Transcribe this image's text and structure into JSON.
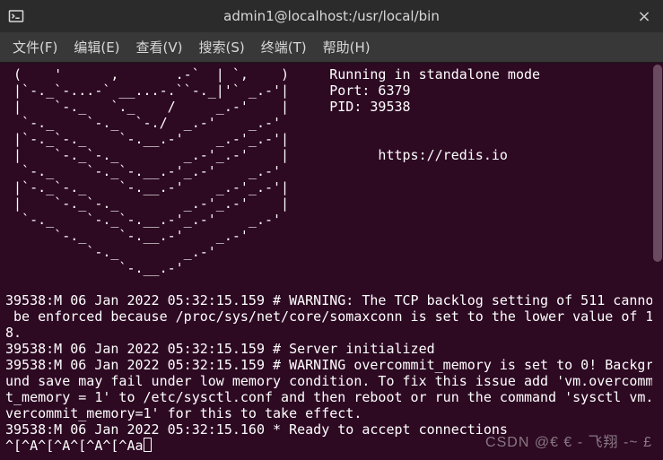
{
  "window": {
    "title": "admin1@localhost:/usr/local/bin",
    "close_label": "×"
  },
  "menu": {
    "file": "文件(F)",
    "edit": "编辑(E)",
    "view": "查看(V)",
    "search": "搜索(S)",
    "terminal": "终端(T)",
    "help": "帮助(H)"
  },
  "terminal": {
    "ascii_art": " (    '      ,       .-`  | `,    )     Running in standalone mode\n |`-._`-...-` __...-.``-._|'` _.-'|     Port: 6379\n |    `-._   `._    /     _.-'    |     PID: 39538\n  `-._    `-._  `-./  _.-'    _.-'\n |`-._`-._    `-.__.-'    _.-'_.-'|\n |    `-._`-._        _.-'_.-'    |           https://redis.io\n  `-._    `-._`-.__.-'_.-'    _.-'\n |`-._`-._    `-.__.-'    _.-'_.-'|\n |    `-._`-._        _.-'_.-'    |\n  `-._    `-._`-.__.-'_.-'    _.-'\n      `-._    `-.__.-'    _.-'\n          `-._        _.-'\n              `-.__.-'\n",
    "log1": "39538:M 06 Jan 2022 05:32:15.159 # WARNING: The TCP backlog setting of 511 cannot be enforced because /proc/sys/net/core/somaxconn is set to the lower value of 128.",
    "log2": "39538:M 06 Jan 2022 05:32:15.159 # Server initialized",
    "log3": "39538:M 06 Jan 2022 05:32:15.159 # WARNING overcommit_memory is set to 0! Background save may fail under low memory condition. To fix this issue add 'vm.overcommit_memory = 1' to /etc/sysctl.conf and then reboot or run the command 'sysctl vm.overcommit_memory=1' for this to take effect.",
    "log4": "39538:M 06 Jan 2022 05:32:15.160 * Ready to accept connections",
    "input": "^[^A^[^A^[^A^[^Aa"
  },
  "watermark": "CSDN @€ € - 飞翔 -~ £"
}
